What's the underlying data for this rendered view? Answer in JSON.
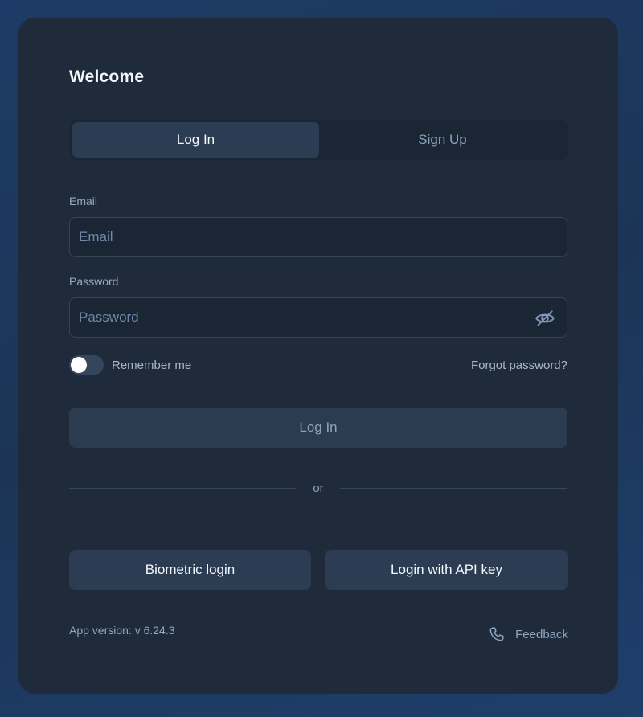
{
  "title": "Welcome",
  "tabs": [
    {
      "label": "Log In",
      "active": true
    },
    {
      "label": "Sign Up",
      "active": false
    }
  ],
  "email": {
    "label": "Email",
    "placeholder": "Email",
    "value": ""
  },
  "password": {
    "label": "Password",
    "placeholder": "Password",
    "value": "",
    "visibility_icon": "eye-off-icon"
  },
  "remember": {
    "label": "Remember me",
    "checked": false
  },
  "forgot_label": "Forgot password?",
  "login_button_label": "Log In",
  "divider_label": "or",
  "alt_logins": {
    "biometric_label": "Biometric login",
    "api_key_label": "Login with API key"
  },
  "footer": {
    "version_label": "App version: v 6.24.3",
    "feedback_label": "Feedback",
    "feedback_icon": "phone-icon"
  },
  "colors": {
    "background": "#1c3556",
    "card": "#1f2b3b",
    "input": "#1b2634",
    "button": "#2c3c52",
    "muted_text": "#8fa6c2"
  }
}
